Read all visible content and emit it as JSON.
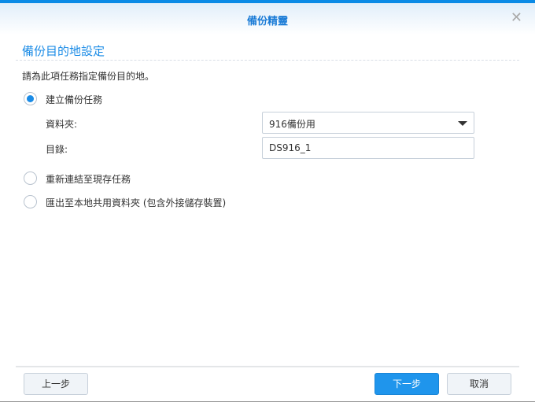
{
  "window": {
    "title": "備份精靈"
  },
  "section": {
    "title": "備份目的地設定",
    "description": "請為此項任務指定備份目的地。"
  },
  "options": [
    {
      "label": "建立備份任務",
      "selected": true
    },
    {
      "label": "重新連結至現存任務",
      "selected": false
    },
    {
      "label": "匯出至本地共用資料夾 (包含外接儲存裝置)",
      "selected": false
    }
  ],
  "form": {
    "folder_label": "資料夾:",
    "folder_value": "916備份用",
    "directory_label": "目錄:",
    "directory_value": "DS916_1"
  },
  "footer": {
    "prev": "上一步",
    "next": "下一步",
    "cancel": "取消"
  }
}
